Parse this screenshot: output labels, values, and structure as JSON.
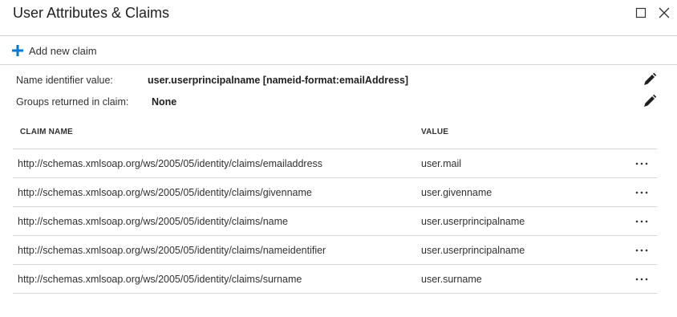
{
  "blade": {
    "title": "User Attributes & Claims",
    "maximize_icon": "maximize-icon",
    "close_icon": "close-icon"
  },
  "command_bar": {
    "add_claim_label": "Add new claim",
    "add_icon": "plus-icon",
    "accent_color": "#0078d4"
  },
  "properties": {
    "name_identifier": {
      "label": "Name identifier value:",
      "value": "user.userprincipalname [nameid-format:emailAddress]"
    },
    "groups": {
      "label": "Groups returned in claim:",
      "value": "None"
    },
    "edit_icon": "pencil-icon"
  },
  "table": {
    "columns": [
      "CLAIM NAME",
      "VALUE"
    ],
    "rows": [
      {
        "name": "http://schemas.xmlsoap.org/ws/2005/05/identity/claims/emailaddress",
        "value": "user.mail"
      },
      {
        "name": "http://schemas.xmlsoap.org/ws/2005/05/identity/claims/givenname",
        "value": "user.givenname"
      },
      {
        "name": "http://schemas.xmlsoap.org/ws/2005/05/identity/claims/name",
        "value": "user.userprincipalname"
      },
      {
        "name": "http://schemas.xmlsoap.org/ws/2005/05/identity/claims/nameidentifier",
        "value": "user.userprincipalname"
      },
      {
        "name": "http://schemas.xmlsoap.org/ws/2005/05/identity/claims/surname",
        "value": "user.surname"
      }
    ],
    "row_action_icon": "more-options-icon"
  }
}
